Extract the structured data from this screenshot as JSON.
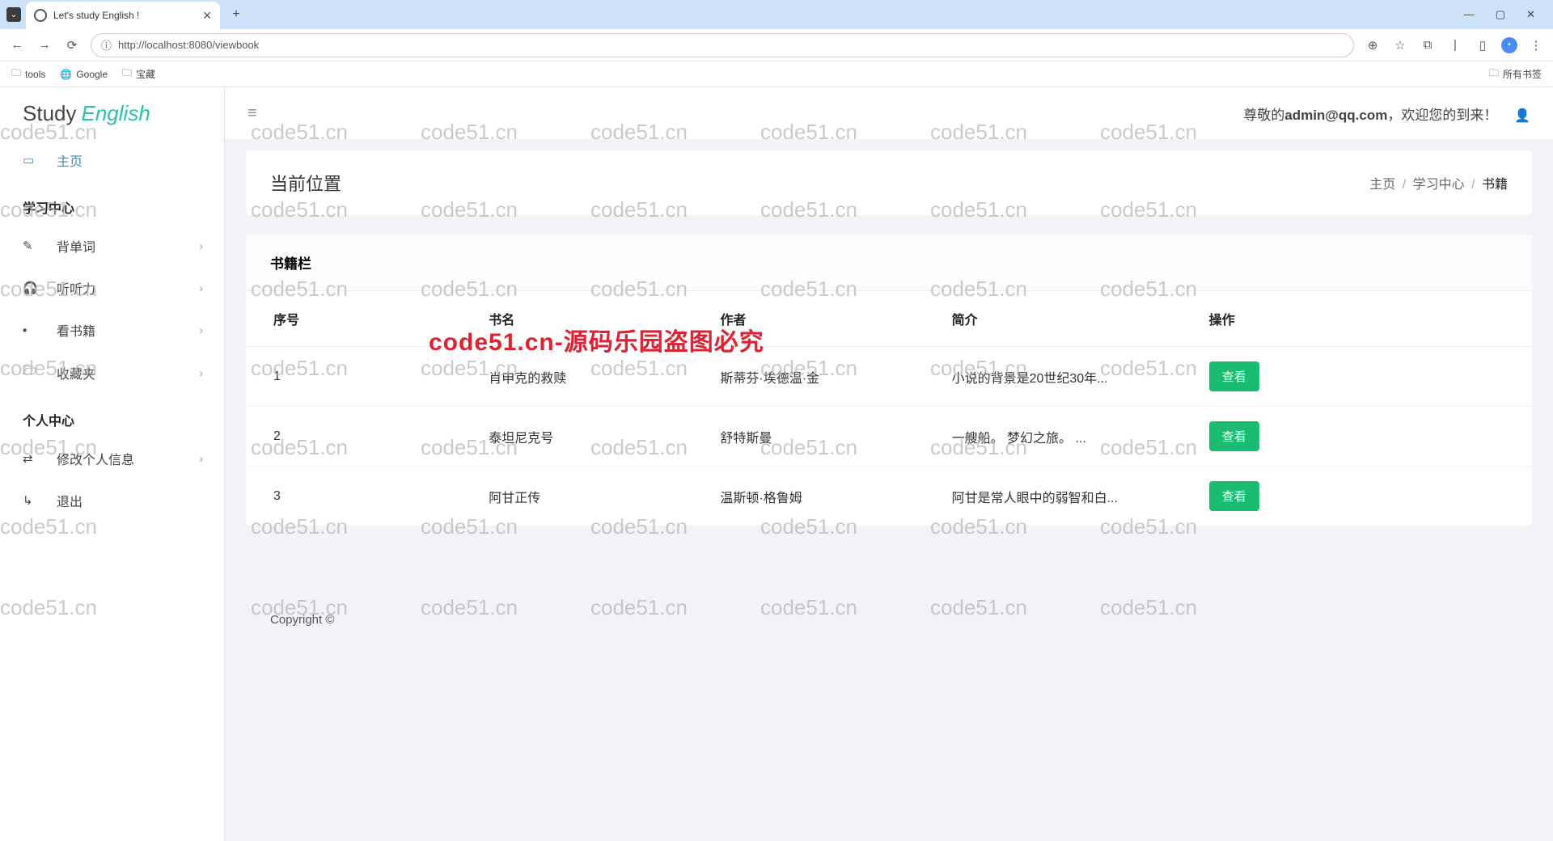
{
  "browser": {
    "tab_title": "Let's study English !",
    "url": "http://localhost:8080/viewbook",
    "bookmarks": [
      "tools",
      "Google",
      "宝藏"
    ],
    "bookmark_right": "所有书签",
    "win": {
      "min": "—",
      "max": "▢",
      "close": "✕"
    }
  },
  "logo": {
    "part1": "Study",
    "part2": "English"
  },
  "sidebar": {
    "home": "主页",
    "section1": "学习中心",
    "items1": [
      "背单词",
      "听听力",
      "看书籍",
      "收藏夹"
    ],
    "section2": "个人中心",
    "items2": [
      "修改个人信息",
      "退出"
    ]
  },
  "topbar": {
    "welcome_pre": "尊敬的",
    "user": "admin@qq.com",
    "welcome_post": "，欢迎您的到来！"
  },
  "crumb": {
    "label": "当前位置",
    "home": "主页",
    "mid": "学习中心",
    "cur": "书籍"
  },
  "panel": {
    "title": "书籍栏",
    "cols": [
      "序号",
      "书名",
      "作者",
      "简介",
      "操作"
    ],
    "view": "查看"
  },
  "rows": [
    {
      "id": "1",
      "name": "肖申克的救赎",
      "author": "斯蒂芬·埃德温·金",
      "desc": "小说的背景是20世纪30年..."
    },
    {
      "id": "2",
      "name": "泰坦尼克号",
      "author": "舒特斯曼",
      "desc": "一艘船。       梦幻之旅。 ..."
    },
    {
      "id": "3",
      "name": "阿甘正传",
      "author": "温斯顿·格鲁姆",
      "desc": "阿甘是常人眼中的弱智和白..."
    }
  ],
  "footer": "Copyright ©",
  "watermark": "code51.cn",
  "watermark_red": "code51.cn-源码乐园盗图必究"
}
